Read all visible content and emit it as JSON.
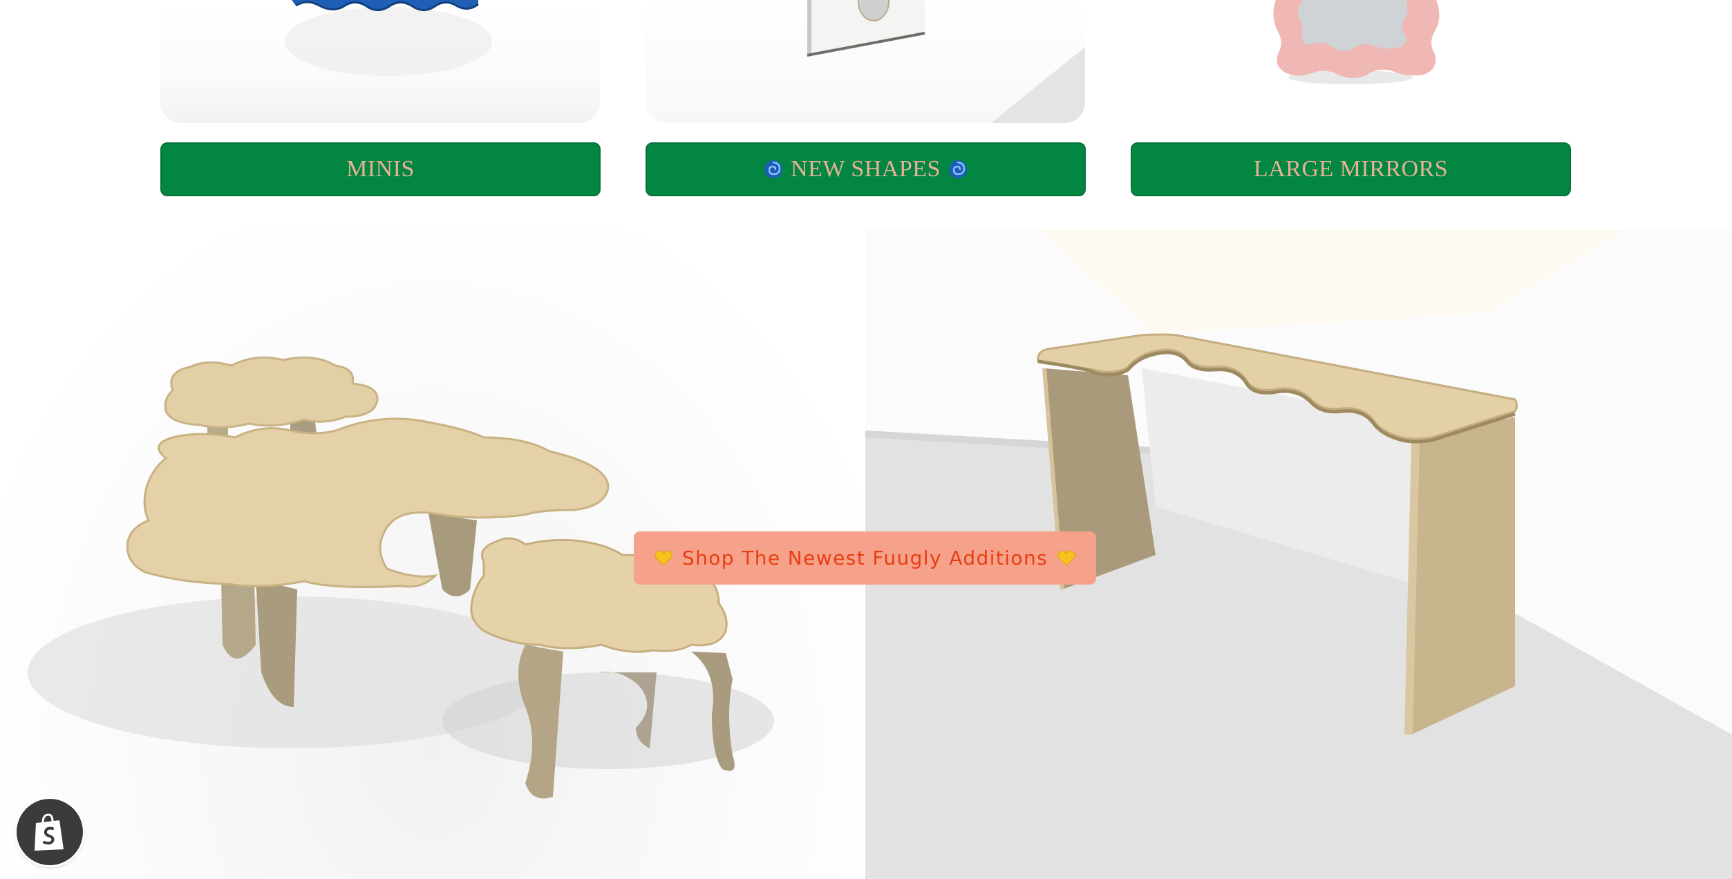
{
  "top_strip": {
    "tiles": [
      {
        "icon": "blue-wavy-mirror-image"
      },
      {
        "icon": "white-framed-mirror-image"
      },
      {
        "icon": "pink-wavy-mirror-image"
      }
    ]
  },
  "categories": {
    "minis_label": "MINIS",
    "new_shapes_label": "NEW SHAPES",
    "large_mirrors_label": "LARGE MIRRORS",
    "new_shapes_icon": "cyclone-icon"
  },
  "hero": {
    "left_image": "wavy-plywood-nesting-tables",
    "right_image": "wavy-plywood-console-table"
  },
  "cta": {
    "label": "Shop The Newest Fuugly Additions",
    "icon": "yellow-heart-icon"
  },
  "shop_badge": {
    "icon": "shopify-bag-icon"
  },
  "colors": {
    "button_green": "#038641",
    "button_text": "#e7b296",
    "cta_bg": "#f6a28a",
    "cta_text": "#e83d12",
    "plywood": "#e2cfa6"
  }
}
